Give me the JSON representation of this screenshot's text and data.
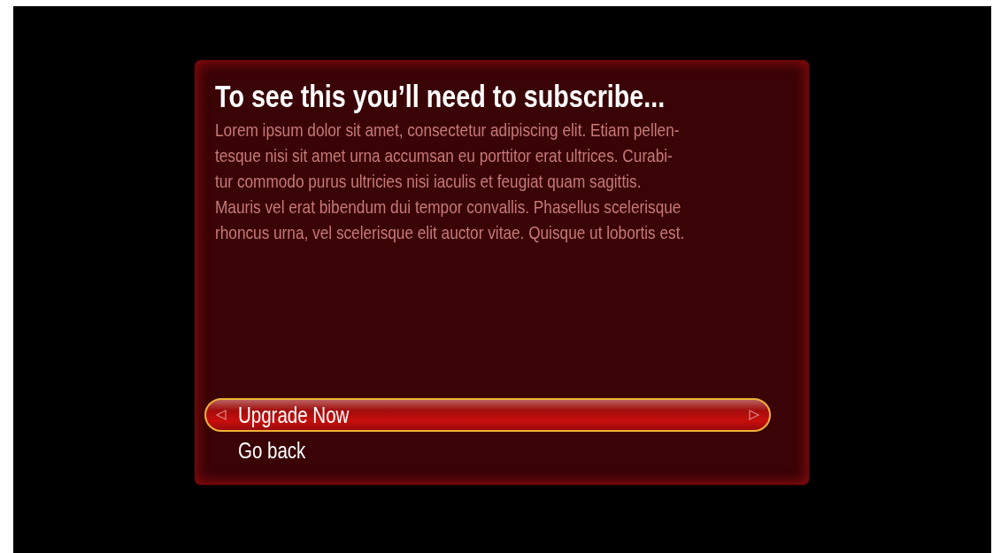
{
  "dialog": {
    "title": "To see this you’ll need to subscribe...",
    "body": "Lorem ipsum dolor sit amet, consectetur adipiscing elit. Etiam pellen-\ntesque nisi sit amet urna accumsan eu porttitor erat ultrices. Curabi-\ntur commodo purus ultricies nisi iaculis et feugiat quam sagittis.\nMauris vel erat bibendum dui tempor convallis. Phasellus scelerisque\nrhoncus urna, vel scelerisque elit auctor vitae. Quisque ut lobortis est.",
    "options": [
      {
        "label": "Upgrade Now",
        "selected": true
      },
      {
        "label": "Go back",
        "selected": false
      }
    ]
  }
}
